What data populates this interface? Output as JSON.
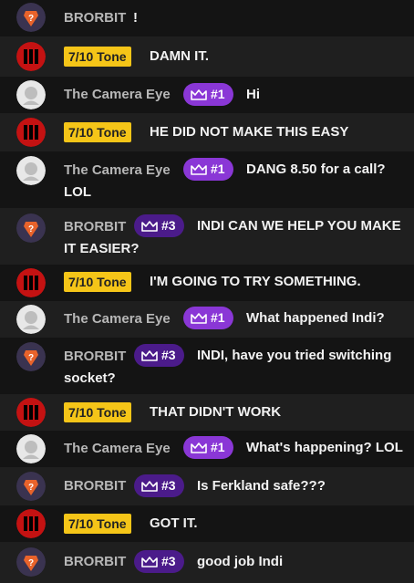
{
  "colors": {
    "tone_tag": "#f5c518",
    "badge_camera": "#8a37d6",
    "badge_brorbit": "#4b1b8a",
    "row_dark": "#1f1f1f",
    "row_light": "#141414"
  },
  "users": {
    "brorbit": "BRORBIT",
    "tone": "7/10 Tone",
    "camera": "The Camera Eye"
  },
  "badges": {
    "camera": "#1",
    "brorbit": "#3"
  },
  "icons": {
    "crown": "crown-icon",
    "brorbit_avatar": "brorbit-avatar",
    "tone_avatar": "tone-avatar",
    "camera_avatar": "camera-eye-avatar"
  },
  "messages": [
    "!",
    "DAMN IT.",
    "Hi",
    "HE DID NOT MAKE THIS EASY",
    "DANG 8.50 for a call? LOL",
    "INDI CAN WE HELP YOU MAKE IT EASIER?",
    "I'M GOING TO TRY SOMETHING.",
    "What happened Indi?",
    "INDI, have you tried switching socket?",
    "THAT DIDN'T WORK",
    "What's happening? LOL",
    "Is Ferkland safe???",
    "GOT IT.",
    "good job Indi"
  ]
}
